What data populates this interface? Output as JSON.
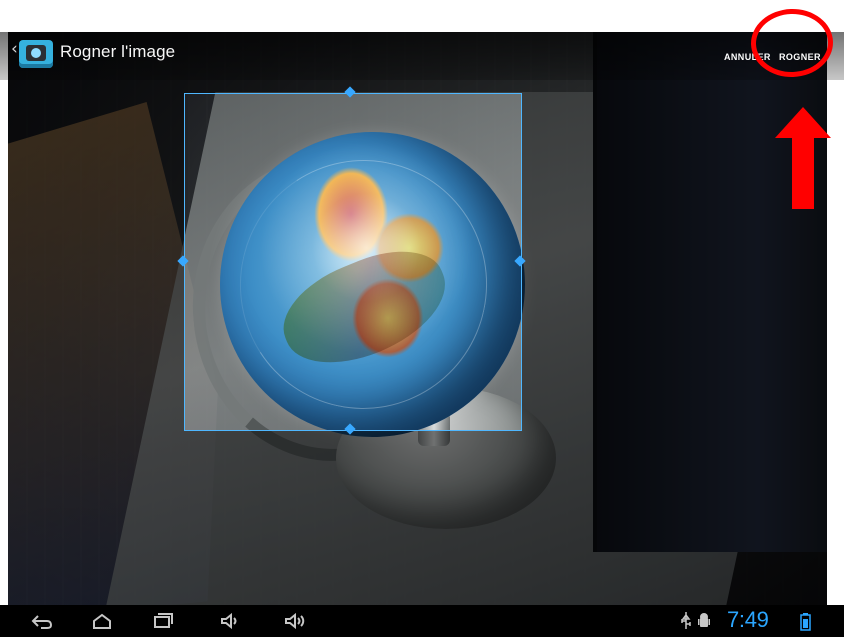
{
  "action_bar": {
    "title": "Rogner l'image",
    "app_icon": "camera-gallery-icon",
    "buttons": [
      {
        "label": "ANNULER",
        "icon": "none"
      },
      {
        "label": "ROGNER",
        "icon": "none"
      }
    ]
  },
  "annotations": {
    "highlight": "red-circle-around-crop-button",
    "pointer": "red-up-arrow",
    "color": "#ff0000"
  },
  "crop_overlay": {
    "border_color": "#4fb7ff",
    "handles": [
      "top-crop-handle",
      "right-crop-handle",
      "bottom-crop-handle",
      "left-crop-handle"
    ]
  },
  "image": {
    "subject": "globe-photo"
  },
  "navigation_bar": {
    "icons": [
      "back-icon",
      "home-icon",
      "recent-apps-icon",
      "volume-down-icon",
      "volume-up-icon"
    ],
    "status_icons": [
      "usb-icon",
      "android-debug-icon",
      "battery-icon"
    ],
    "time": "7:49",
    "time_color": "#2ba6ff"
  }
}
